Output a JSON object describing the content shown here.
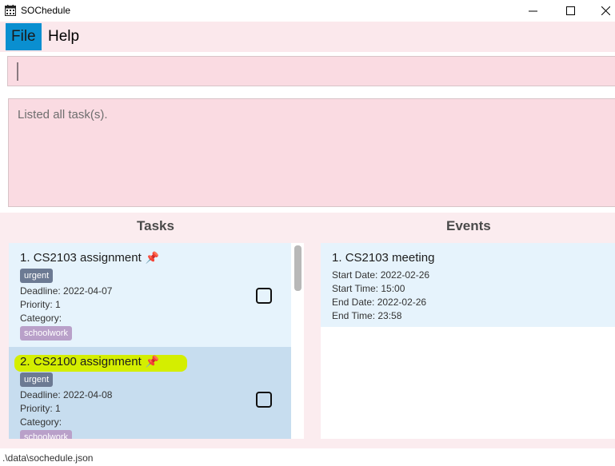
{
  "window": {
    "title": "SOChedule",
    "controls": {
      "minimize": "—",
      "maximize": "☐",
      "close": "✕"
    }
  },
  "menu": {
    "file": "File",
    "help": "Help"
  },
  "command": {
    "value": ""
  },
  "result": {
    "text": "Listed all task(s)."
  },
  "tasks": {
    "header": "Tasks",
    "items": [
      {
        "index": "1.",
        "name": "CS2103 assignment",
        "pin_icon": "📌",
        "tag": "urgent",
        "deadline": "Deadline: 2022-04-07",
        "priority": "Priority: 1",
        "category_label": "Category:",
        "category": "schoolwork",
        "completed": false
      },
      {
        "index": "2.",
        "name": "CS2100 assignment",
        "pin_icon": "📌",
        "tag": "urgent",
        "deadline": "Deadline: 2022-04-08",
        "priority": "Priority: 1",
        "category_label": "Category:",
        "category": "schoolwork",
        "completed": false,
        "highlighted": true,
        "highlight_color": "#d4ee00"
      }
    ]
  },
  "events": {
    "header": "Events",
    "items": [
      {
        "index": "1.",
        "name": "CS2103 meeting",
        "start_date": "Start Date: 2022-02-26",
        "start_time": "Start Time: 15:00",
        "end_date": "End Date: 2022-02-26",
        "end_time": "End Time: 23:58"
      }
    ]
  },
  "status": {
    "path": ".\\data\\sochedule.json"
  },
  "colors": {
    "accent": "#0a8fd0",
    "background_pink": "#fbe8ec",
    "input_pink": "#fadbe2",
    "card_blue": "#e6f3fc",
    "card_selected": "#c7ddef",
    "tag_urgent": "#6c7a93",
    "tag_category": "#b9a0c9"
  },
  "icons": {
    "app": "calendar-icon",
    "pin": "pushpin-icon",
    "checkbox": "checkbox-icon"
  }
}
